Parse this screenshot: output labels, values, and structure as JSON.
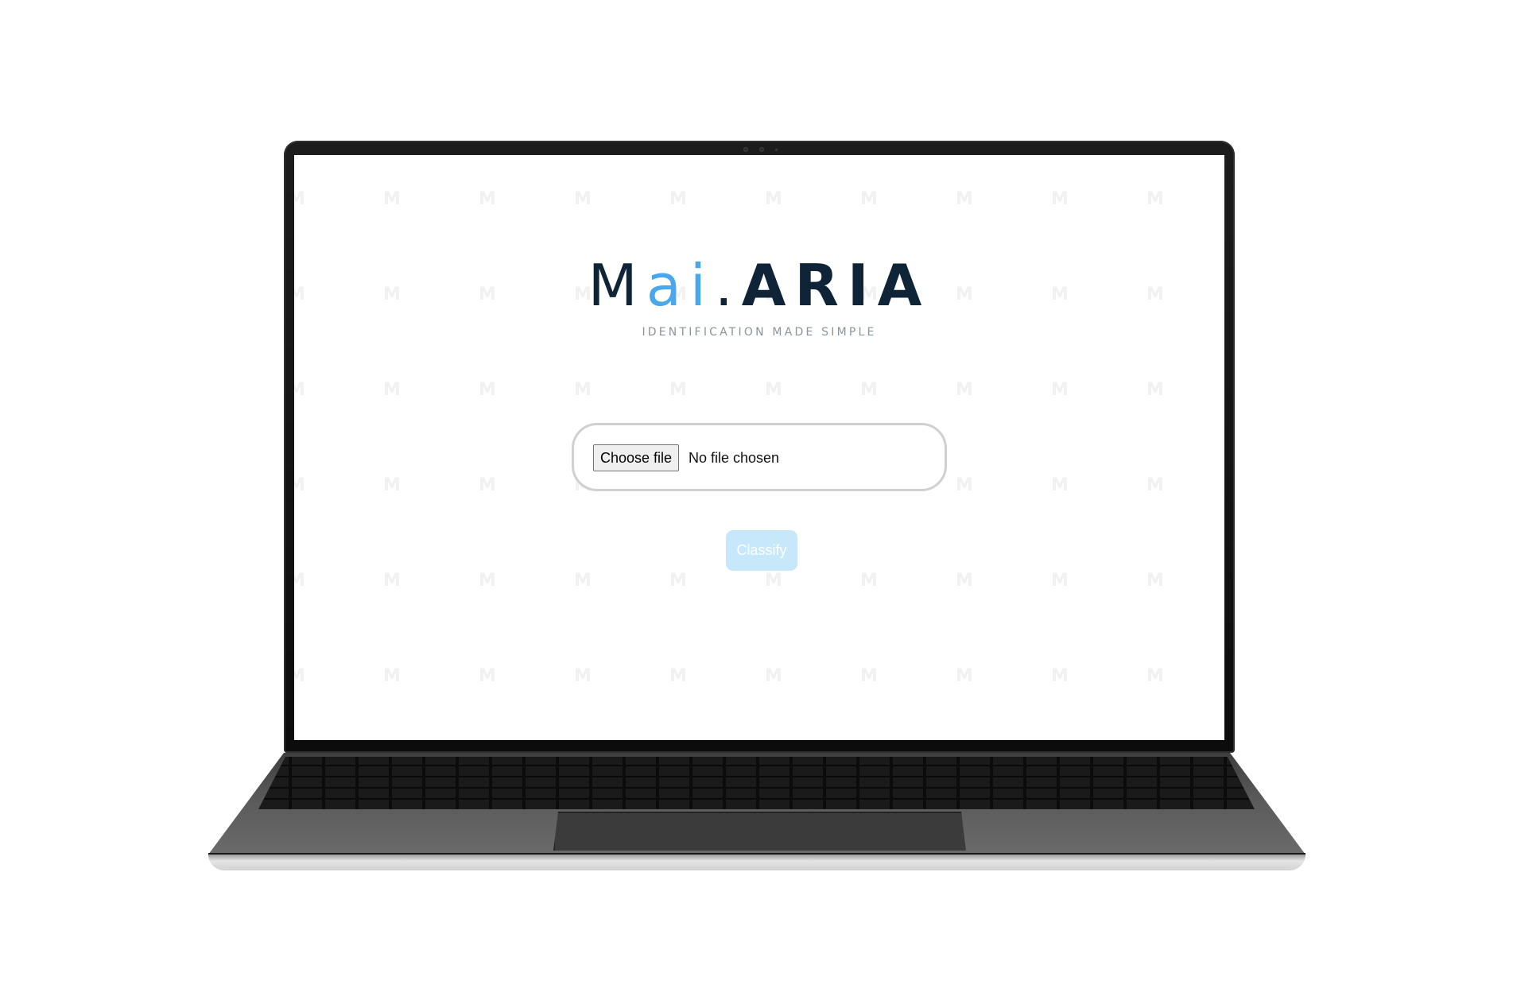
{
  "logo": {
    "part_m": "M",
    "part_ai": "ai",
    "part_dot": ".",
    "part_aria": "ARIA",
    "tagline": "IDENTIFICATION MADE SIMPLE"
  },
  "upload": {
    "choose_button_label": "Choose file",
    "status_text": "No file chosen"
  },
  "classify": {
    "label": "Classify"
  },
  "watermark": {
    "glyph": "M"
  },
  "colors": {
    "brand_dark": "#0f2436",
    "brand_accent": "#4aa7ec",
    "classify_disabled_bg": "#c7e8fb"
  }
}
